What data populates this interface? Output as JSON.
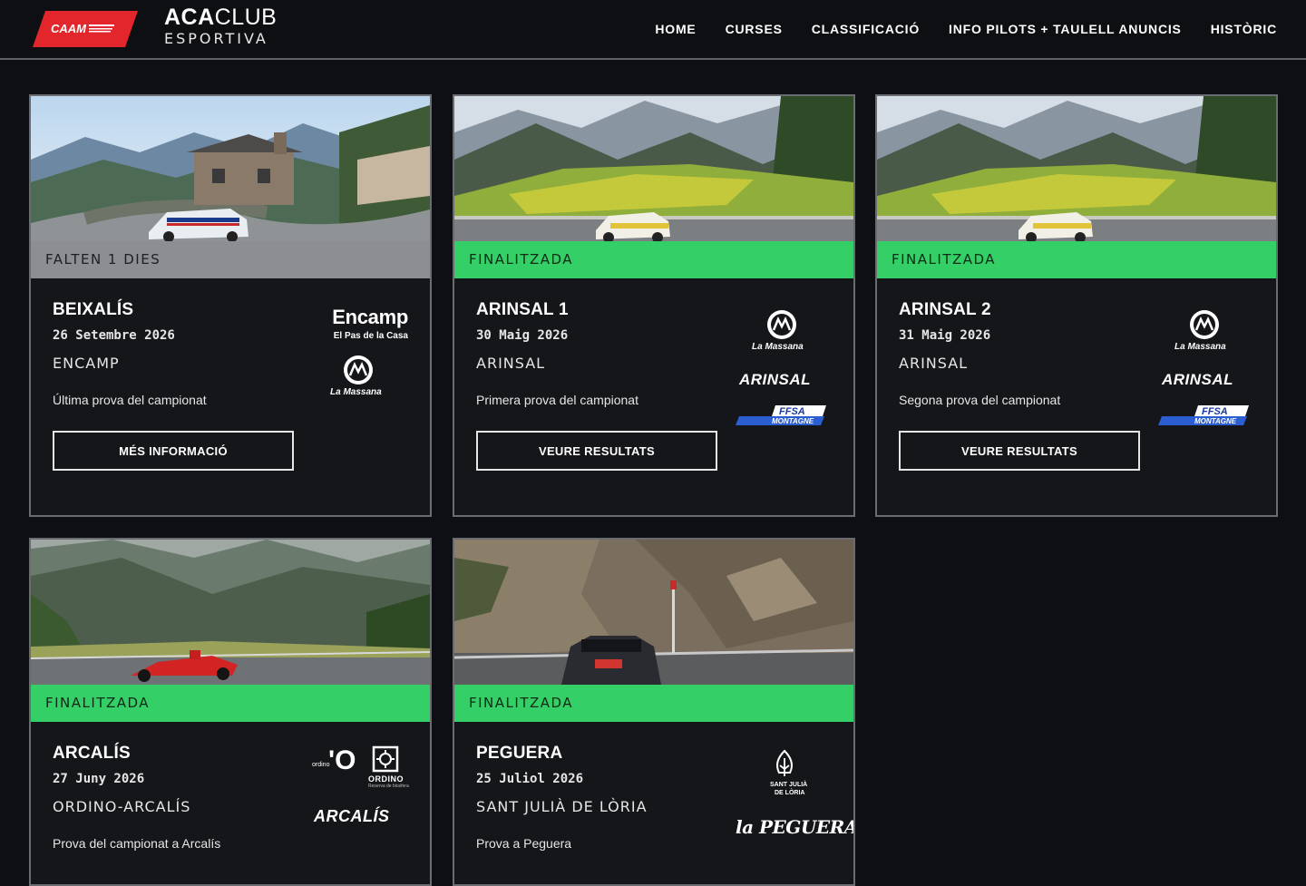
{
  "header": {
    "caam_logo_text": "CAAM",
    "brand_main_bold": "ACA",
    "brand_main_light": "CLUB",
    "brand_sub": "ESPORTIVA",
    "nav": [
      "HOME",
      "CURSES",
      "CLASSIFICACIÓ",
      "INFO PILOTS + TAULELL ANUNCIS",
      "HISTÒRIC"
    ]
  },
  "cards": [
    {
      "status": "FALTEN 1 DIES",
      "status_kind": "upcoming",
      "title": "BEIXALÍS",
      "date": "26 Setembre 2026",
      "place": "ENCAMP",
      "description": "Última prova del campionat",
      "button": "MÉS INFORMACIÓ",
      "logos": {
        "encamp": "Encamp",
        "encamp_sub": "El Pas de la Casa",
        "massana": "La Massana"
      }
    },
    {
      "status": "FINALITZADA",
      "status_kind": "finished",
      "title": "ARINSAL 1",
      "date": "30 Maig 2026",
      "place": "ARINSAL",
      "description": "Primera prova del campionat",
      "button": "VEURE RESULTATS",
      "logos": {
        "massana": "La Massana",
        "arinsal": "ARINSAL",
        "ffsa": "FFSA",
        "ffsa_sub": "MONTAGNE"
      }
    },
    {
      "status": "FINALITZADA",
      "status_kind": "finished",
      "title": "ARINSAL 2",
      "date": "31 Maig 2026",
      "place": "ARINSAL",
      "description": "Segona prova del campionat",
      "button": "VEURE RESULTATS",
      "logos": {
        "massana": "La Massana",
        "arinsal": "ARINSAL",
        "ffsa": "FFSA",
        "ffsa_sub": "MONTAGNE"
      }
    },
    {
      "status": "FINALITZADA",
      "status_kind": "finished",
      "title": "ARCALÍS",
      "date": "27 Juny 2026",
      "place": "ORDINO-ARCALÍS",
      "description": "Prova del campionat a Arcalís",
      "logos": {
        "ordino_small": "ordino",
        "ordino_big": "'O",
        "ordino": "ORDINO",
        "ordino_sub": "Reserva de biosfera",
        "arcalis": "ARCALÍS"
      }
    },
    {
      "status": "FINALITZADA",
      "status_kind": "finished",
      "title": "PEGUERA",
      "date": "25 Juliol 2026",
      "place": "SANT JULIÀ DE LÒRIA",
      "description": "Prova a Peguera",
      "logos": {
        "santjulia_1": "SANT JULIÀ",
        "santjulia_2": "DE LÒRIA",
        "peguera": "la PEGUERA"
      }
    }
  ],
  "colors": {
    "finished": "#35cf67",
    "upcoming": "#8c8e93",
    "caam_red": "#e3262c"
  }
}
